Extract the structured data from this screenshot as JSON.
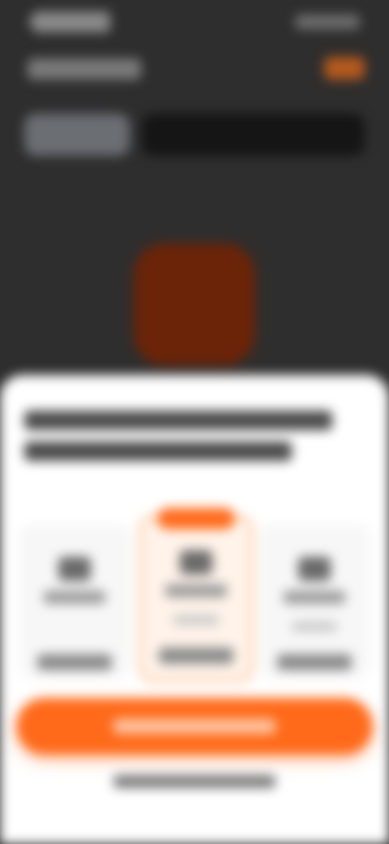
{
  "icons": {
    "status_time": "clock-icon",
    "system": "system-status-icons",
    "header_action": "close-icon",
    "hero": "app-logo-icon"
  },
  "colors": {
    "background_dark": "#2f2e2e",
    "accent": "#ff6a1a",
    "hero_tile": "#6b2408",
    "sheet": "#ffffff",
    "featured_border": "#ff8a3c"
  },
  "plans": [
    {
      "featured": false
    },
    {
      "featured": true
    },
    {
      "featured": false
    }
  ]
}
